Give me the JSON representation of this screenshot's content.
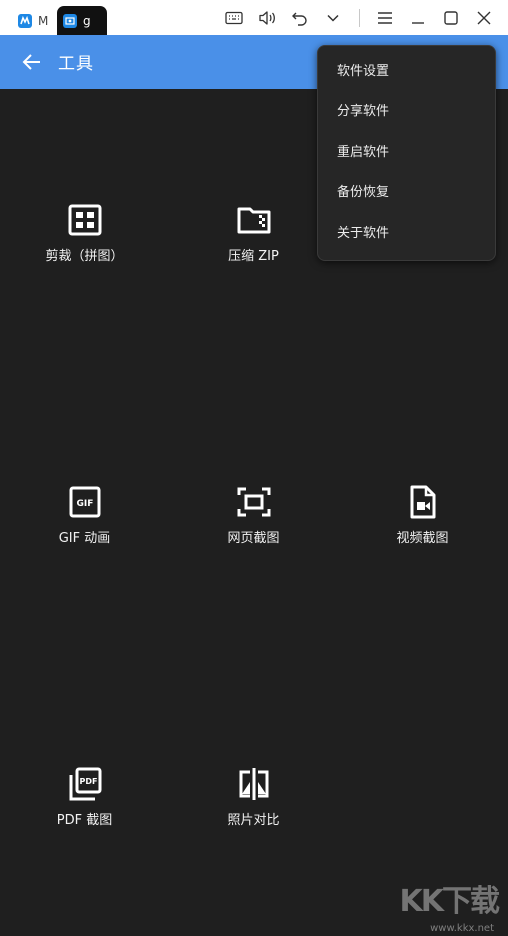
{
  "titlebar": {
    "tab1_label": "M",
    "tab2_label": "g",
    "icons": [
      "keyboard-icon",
      "volume-icon",
      "undo-icon",
      "chevron-down-icon",
      "menu-icon",
      "minimize-icon",
      "maximize-icon",
      "close-icon"
    ]
  },
  "appbar": {
    "title": "工具"
  },
  "tools": [
    {
      "label": "剪裁（拼图）",
      "icon": "grid-icon"
    },
    {
      "label": "压缩 ZIP",
      "icon": "zip-folder-icon"
    },
    {
      "label": "GIF 动画",
      "icon": "gif-icon"
    },
    {
      "label": "网页截图",
      "icon": "screen-capture-icon"
    },
    {
      "label": "视频截图",
      "icon": "video-file-icon"
    },
    {
      "label": "PDF 截图",
      "icon": "pdf-icon"
    },
    {
      "label": "照片对比",
      "icon": "compare-icon"
    }
  ],
  "menu": {
    "items": [
      "软件设置",
      "分享软件",
      "重启软件",
      "备份恢复",
      "关于软件"
    ]
  },
  "watermark": {
    "big": "KK下载",
    "small": "www.kkx.net"
  },
  "colors": {
    "appbar": "#4a90e8",
    "background": "#1f1f1f",
    "menu": "#262626"
  }
}
